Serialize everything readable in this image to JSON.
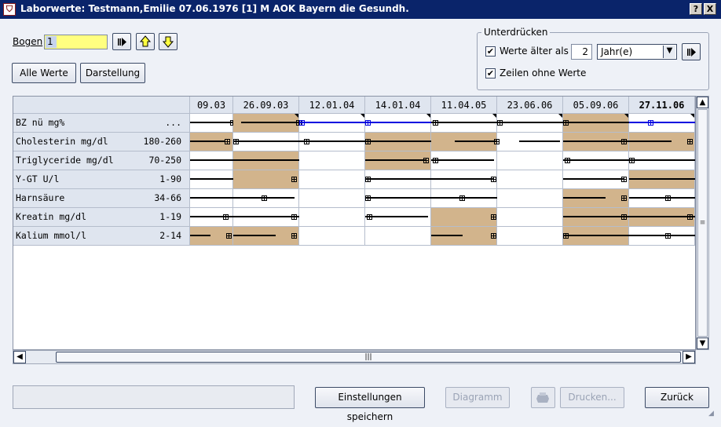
{
  "window": {
    "title": "Laborwerte: Testmann,Emilie 07.06.1976  [1]  M AOK Bayern die Gesundh.",
    "help_button": "?",
    "close_button": "X"
  },
  "bogen": {
    "label": "Bogen",
    "value": "1"
  },
  "buttons": {
    "alle_werte": "Alle Werte",
    "darstellung": "Darstellung",
    "einstellungen": "Einstellungen speichern",
    "diagramm": "Diagramm",
    "drucken": "Drucken...",
    "zurueck": "Zurück"
  },
  "unterdruecken": {
    "legend": "Unterdrücken",
    "werte_aelter_als_label": "Werte älter als",
    "werte_aelter_als_checked": true,
    "amount": "2",
    "unit": "Jahr(e)",
    "zeilen_ohne_werte_label": "Zeilen ohne Werte",
    "zeilen_ohne_werte_checked": true
  },
  "table": {
    "dates": [
      "09.03",
      "26.09.03",
      "12.01.04",
      "14.01.04",
      "11.04.05",
      "23.06.06",
      "05.09.06",
      "27.11.06"
    ],
    "bold_date_index": 7,
    "rows": [
      {
        "name": "BZ nü mg%",
        "range": "..."
      },
      {
        "name": "Cholesterin mg/dl",
        "range": "180-260"
      },
      {
        "name": "Triglyceride mg/dl",
        "range": "70-250"
      },
      {
        "name": "Y-GT U/l",
        "range": "1-90"
      },
      {
        "name": "Harnsäure",
        "range": "34-66"
      },
      {
        "name": "Kreatin mg/dl",
        "range": "1-19"
      },
      {
        "name": "Kalium mmol/l",
        "range": "2-14"
      }
    ]
  },
  "colors": {
    "out_of_range": "#d2b48c",
    "highlight_line": "#0000e0",
    "titlebar": "#0a246a"
  }
}
